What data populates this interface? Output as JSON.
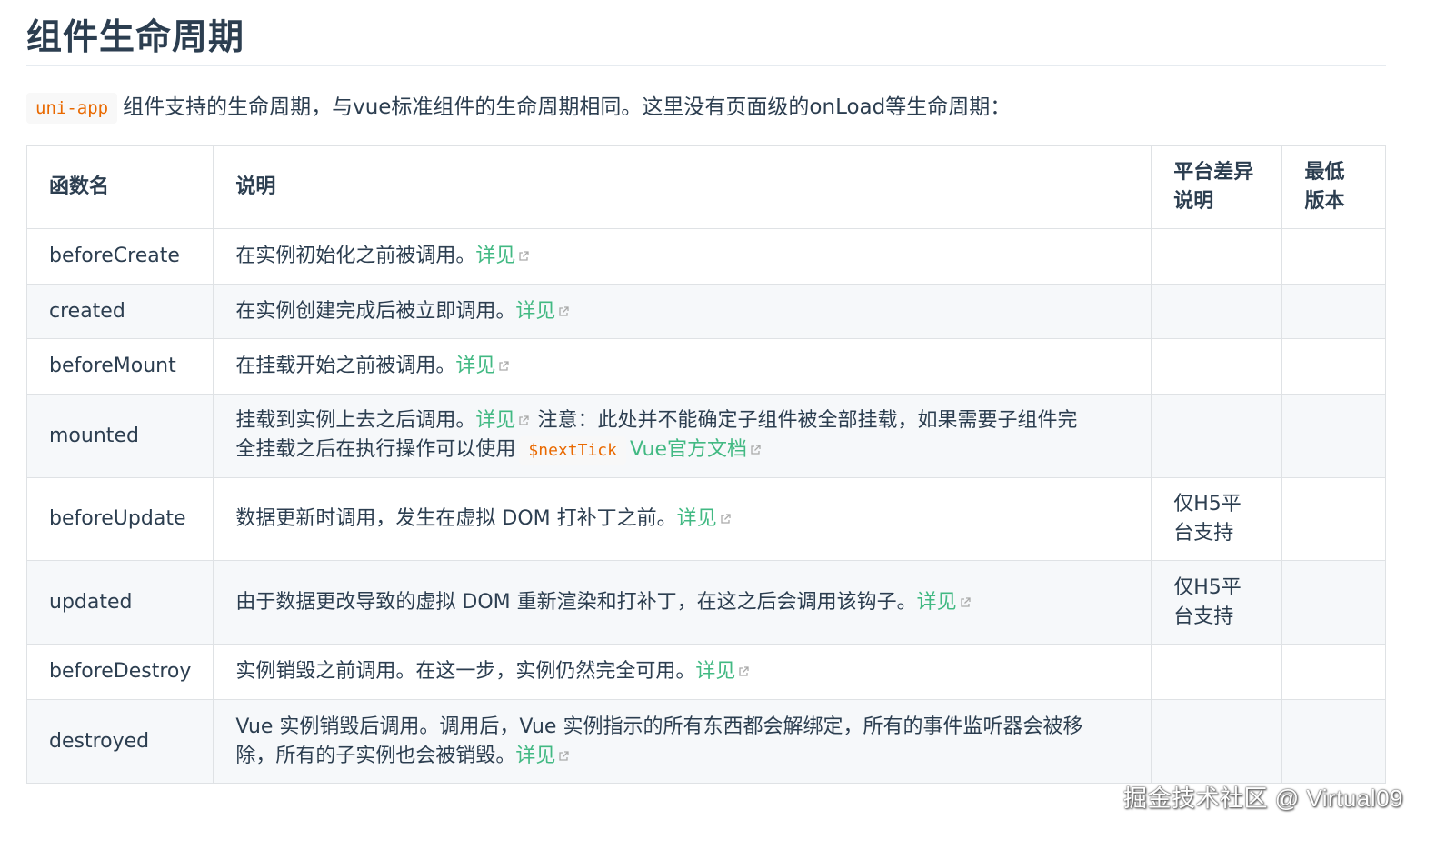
{
  "heading": "组件生命周期",
  "intro": {
    "code": "uni-app",
    "text": "组件支持的生命周期，与vue标准组件的生命周期相同。这里没有页面级的onLoad等生命周期："
  },
  "table": {
    "headers": {
      "name": "函数名",
      "desc": "说明",
      "platform_line1": "平台差异",
      "platform_line2": "说明",
      "version_line1": "最低",
      "version_line2": "版本"
    },
    "link_label": "详见",
    "rows": [
      {
        "name": "beforeCreate",
        "desc": "在实例初始化之前被调用。",
        "platform": ""
      },
      {
        "name": "created",
        "desc": "在实例创建完成后被立即调用。",
        "platform": ""
      },
      {
        "name": "beforeMount",
        "desc": "在挂载开始之前被调用。",
        "platform": ""
      },
      {
        "name": "mounted",
        "desc": "挂载到实例上去之后调用。",
        "note_line1": "注意：此处并不能确定子组件被全部挂载，如果需要子组件完",
        "note_line2": "全挂载之后在执行操作可以使用",
        "code": "$nextTick",
        "doc_link": "Vue官方文档",
        "platform": ""
      },
      {
        "name": "beforeUpdate",
        "desc": "数据更新时调用，发生在虚拟 DOM 打补丁之前。",
        "platform_line1": "仅H5平",
        "platform_line2": "台支持"
      },
      {
        "name": "updated",
        "desc": "由于数据更改导致的虚拟 DOM 重新渲染和打补丁，在这之后会调用该钩子。",
        "platform_line1": "仅H5平",
        "platform_line2": "台支持"
      },
      {
        "name": "beforeDestroy",
        "desc": "实例销毁之前调用。在这一步，实例仍然完全可用。",
        "platform": ""
      },
      {
        "name": "destroyed",
        "desc_line1": "Vue 实例销毁后调用。调用后，Vue 实例指示的所有东西都会解绑定，所有的事件监听器会被移",
        "desc_line2": "除，所有的子实例也会被销毁。",
        "platform": ""
      }
    ]
  },
  "watermark": "掘金技术社区 @ Virtual09",
  "colors": {
    "text": "#2c3e50",
    "link": "#42b983",
    "code": "#e96900",
    "zebra": "#f6f8fa",
    "border": "#dfe2e5"
  }
}
